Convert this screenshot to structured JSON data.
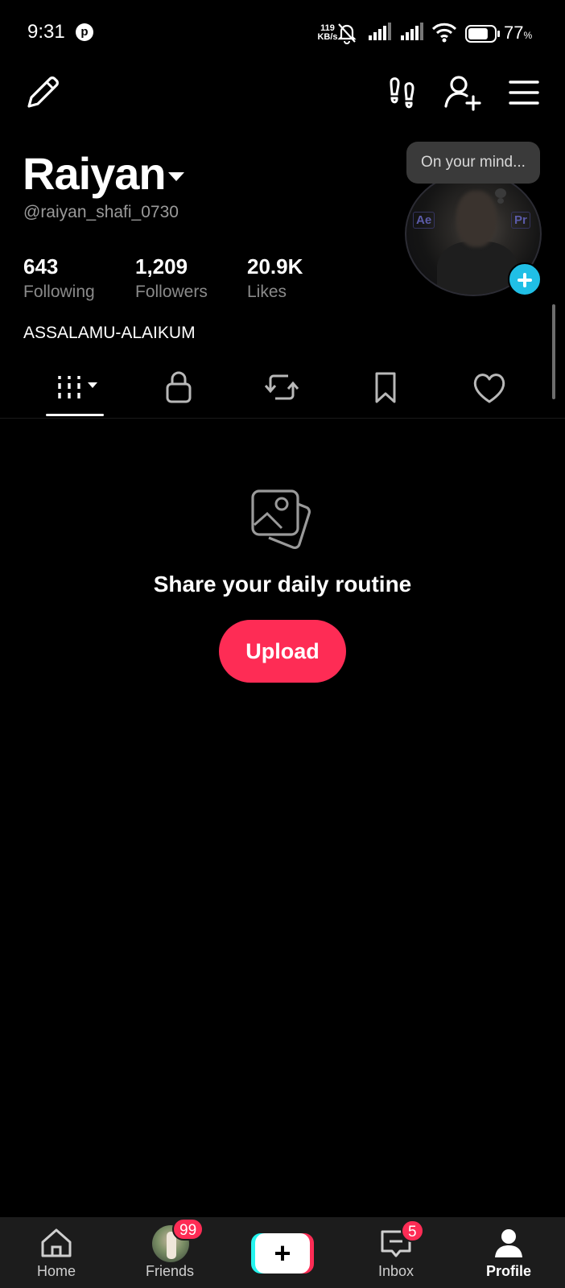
{
  "status_bar": {
    "time": "9:31",
    "net_speed_value": "119",
    "net_speed_unit": "KB/s",
    "battery_percent": "77",
    "battery_unit": "%",
    "battery_level": 0.77,
    "icons": [
      "pinterest-icon",
      "bell-off-icon",
      "signal-icon",
      "signal-icon",
      "wifi-icon",
      "battery-icon"
    ]
  },
  "header": {
    "icons": [
      "pencil-icon",
      "footprints-icon",
      "add-friend-icon",
      "menu-icon"
    ]
  },
  "profile": {
    "display_name": "Raiyan",
    "handle": "@raiyan_shafi_0730",
    "stats": [
      {
        "value": "643",
        "label": "Following"
      },
      {
        "value": "1,209",
        "label": "Followers"
      },
      {
        "value": "20.9K",
        "label": "Likes"
      }
    ],
    "bio": "ASSALAMU-ALAIKUM",
    "status_bubble": "On your mind...",
    "avatar_badges": [
      "Ae",
      "Pr"
    ]
  },
  "tabs": [
    "videos-grid-icon",
    "lock-icon",
    "repost-icon",
    "bookmark-icon",
    "heart-icon"
  ],
  "empty_state": {
    "icon": "photos-icon",
    "title": "Share your daily routine",
    "button": "Upload"
  },
  "bottom_nav": {
    "items": [
      {
        "label": "Home",
        "icon": "home-icon"
      },
      {
        "label": "Friends",
        "badge": "99"
      },
      {
        "label": "",
        "icon": "plus-icon"
      },
      {
        "label": "Inbox",
        "icon": "inbox-icon",
        "badge": "5"
      },
      {
        "label": "Profile",
        "icon": "person-icon",
        "active": true
      }
    ]
  },
  "colors": {
    "background": "#000000",
    "accent": "#fe2c55",
    "avatar_add": "#20bfe6",
    "create_left": "#25f4ee"
  }
}
